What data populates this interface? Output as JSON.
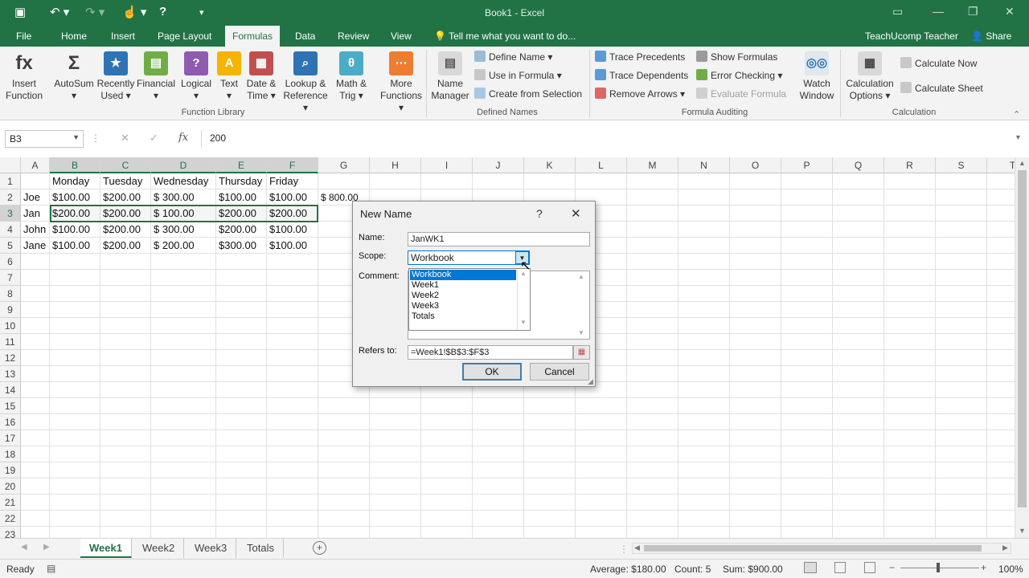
{
  "window": {
    "title": "Book1 - Excel",
    "user": "TeachUcomp Teacher",
    "share": "Share"
  },
  "tabs": [
    "File",
    "Home",
    "Insert",
    "Page Layout",
    "Formulas",
    "Data",
    "Review",
    "View"
  ],
  "tell_me": "Tell me what you want to do...",
  "ribbon": {
    "function_library": {
      "group_label": "Function Library",
      "buttons": [
        {
          "l1": "Insert",
          "l2": "Function",
          "icon": "fx-icon",
          "color": "#3f3f3f"
        },
        {
          "l1": "AutoSum",
          "l2": "▾",
          "icon": "sigma-icon",
          "color": "#3f3f3f"
        },
        {
          "l1": "Recently",
          "l2": "Used ▾",
          "icon": "star-book-icon",
          "color": "#2e74b5"
        },
        {
          "l1": "Financial",
          "l2": "▾",
          "icon": "financial-book-icon",
          "color": "#70ad47"
        },
        {
          "l1": "Logical",
          "l2": "▾",
          "icon": "logical-book-icon",
          "color": "#8e5bb0"
        },
        {
          "l1": "Text",
          "l2": "▾",
          "icon": "text-book-icon",
          "color": "#f4b400"
        },
        {
          "l1": "Date &",
          "l2": "Time ▾",
          "icon": "date-book-icon",
          "color": "#c0504d"
        },
        {
          "l1": "Lookup &",
          "l2": "Reference ▾",
          "icon": "lookup-book-icon",
          "color": "#2e74b5"
        },
        {
          "l1": "Math &",
          "l2": "Trig ▾",
          "icon": "math-book-icon",
          "color": "#4bacc6"
        },
        {
          "l1": "More",
          "l2": "Functions ▾",
          "icon": "more-book-icon",
          "color": "#ed7d31"
        }
      ]
    },
    "defined_names": {
      "group_label": "Defined Names",
      "name_manager": {
        "l1": "Name",
        "l2": "Manager"
      },
      "items": [
        "Define Name  ▾",
        "Use in Formula ▾",
        "Create from Selection"
      ]
    },
    "formula_auditing": {
      "group_label": "Formula Auditing",
      "items_left": [
        "Trace Precedents",
        "Trace Dependents",
        "Remove Arrows  ▾"
      ],
      "items_right": [
        "Show Formulas",
        "Error Checking  ▾",
        "Evaluate Formula"
      ],
      "watch": {
        "l1": "Watch",
        "l2": "Window"
      }
    },
    "calculation": {
      "group_label": "Calculation",
      "options": {
        "l1": "Calculation",
        "l2": "Options ▾"
      },
      "items": [
        "Calculate Now",
        "Calculate Sheet"
      ]
    }
  },
  "formula_bar": {
    "name_box": "B3",
    "value": "200",
    "fx": "fx"
  },
  "columns": [
    "A",
    "B",
    "C",
    "D",
    "E",
    "F",
    "G",
    "H",
    "I",
    "J",
    "K",
    "L",
    "M",
    "N",
    "O",
    "P",
    "Q",
    "R",
    "S",
    "T"
  ],
  "rows": [
    "1",
    "2",
    "3",
    "4",
    "5",
    "6",
    "7",
    "8",
    "9",
    "10",
    "11",
    "12",
    "13",
    "14",
    "15",
    "16",
    "17",
    "18",
    "19",
    "20",
    "21",
    "22",
    "23"
  ],
  "cells": {
    "r1": [
      "",
      "Monday",
      "Tuesday",
      "Wednesday",
      "Thursday",
      "Friday",
      ""
    ],
    "r2": [
      "Joe",
      "$100.00",
      "$200.00",
      "$        300.00",
      "$100.00",
      "$100.00",
      "$ 800.00"
    ],
    "r3": [
      "Jan",
      "$200.00",
      "$200.00",
      "$        100.00",
      "$200.00",
      "$200.00",
      ""
    ],
    "r4": [
      "John",
      "$100.00",
      "$200.00",
      "$        300.00",
      "$200.00",
      "$100.00",
      ""
    ],
    "r5": [
      "Jane",
      "$100.00",
      "$200.00",
      "$        200.00",
      "$300.00",
      "$100.00",
      ""
    ]
  },
  "dialog": {
    "title": "New Name",
    "help": "?",
    "close": "✕",
    "name_label": "Name:",
    "name_value": "JanWK1",
    "scope_label": "Scope:",
    "scope_value": "Workbook",
    "scope_options": [
      "Workbook",
      "Week1",
      "Week2",
      "Week3",
      "Totals"
    ],
    "comment_label": "Comment:",
    "refers_label": "Refers to:",
    "refers_value": "=Week1!$B$3:$F$3",
    "ok": "OK",
    "cancel": "Cancel"
  },
  "sheets": [
    "Week1",
    "Week2",
    "Week3",
    "Totals"
  ],
  "status": {
    "ready": "Ready",
    "average": "Average: $180.00",
    "count": "Count: 5",
    "sum": "Sum: $900.00",
    "zoom": "100%"
  }
}
